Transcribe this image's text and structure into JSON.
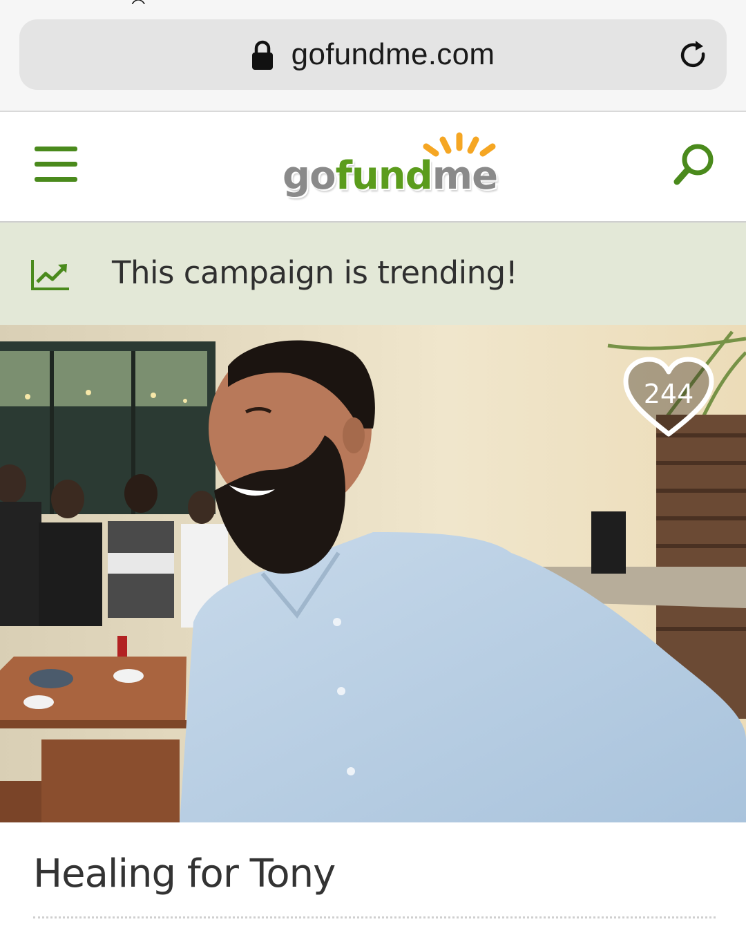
{
  "browser": {
    "url": "gofundme.com",
    "lock_icon": "lock-icon",
    "reload_icon": "reload-icon"
  },
  "header": {
    "menu_icon": "hamburger-menu-icon",
    "logo": {
      "part1": "go",
      "part2": "fund",
      "part3": "me"
    },
    "search_icon": "search-icon",
    "accent_color": "#4a8a1c"
  },
  "trending": {
    "icon": "trending-chart-icon",
    "text": "This campaign is trending!",
    "background": "#e3e8d7"
  },
  "hero": {
    "heart_icon": "heart-icon",
    "heart_count": "244"
  },
  "campaign": {
    "title": "Healing for Tony"
  }
}
